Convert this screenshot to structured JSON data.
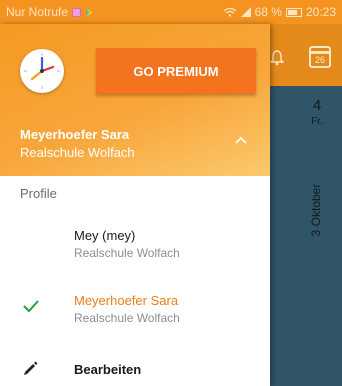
{
  "status_bar": {
    "left_text": "Nur Notrufe",
    "battery_text": "68 %",
    "time": "20:23",
    "icons": [
      "sim-icon",
      "play-store-icon",
      "wifi-icon",
      "signal-icon",
      "battery-icon"
    ]
  },
  "background": {
    "calendar_day_number": "26",
    "date_day": "4",
    "date_weekday": "Fr.",
    "date_month": "3 Oktober",
    "colors": {
      "header": "#e48a1b",
      "content": "#2f5566"
    }
  },
  "drawer": {
    "header": {
      "premium_button": "GO PREMIUM",
      "user_name": "Meyerhoefer Sara",
      "user_school": "Realschule Wolfach",
      "logo_icon": "clock-logo-icon",
      "expand_icon": "chevron-up-icon"
    },
    "section_label": "Profile",
    "profiles": [
      {
        "name": "Mey (mey)",
        "school": "Realschule Wolfach",
        "selected": false
      },
      {
        "name": "Meyerhoefer Sara",
        "school": "Realschule Wolfach",
        "selected": true
      }
    ],
    "edit_label": "Bearbeiten",
    "edit_icon": "pencil-icon",
    "colors": {
      "accent": "#f07d1a",
      "premium_button": "#f4731f",
      "check": "#2e9b46"
    }
  }
}
